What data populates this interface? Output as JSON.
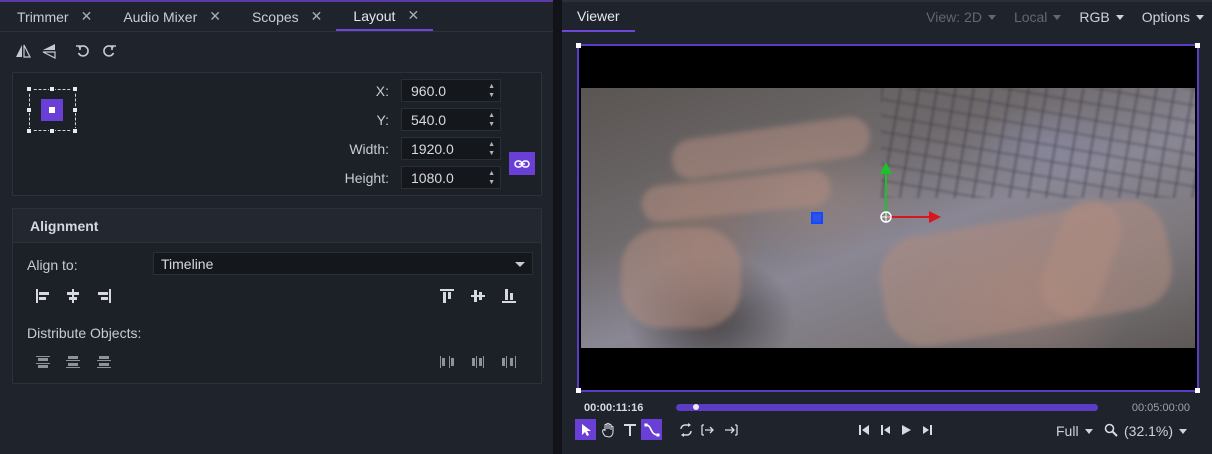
{
  "left_panel": {
    "tabs": [
      {
        "label": "Trimmer",
        "active": false
      },
      {
        "label": "Audio Mixer",
        "active": false
      },
      {
        "label": "Scopes",
        "active": false
      },
      {
        "label": "Layout",
        "active": true
      }
    ],
    "close_glyph": "✕",
    "toolbar": [
      "flip-horizontal-icon",
      "flip-vertical-icon",
      "rotate-left-icon",
      "rotate-right-icon"
    ],
    "transform": {
      "x_label": "X:",
      "x_value": "960.0",
      "y_label": "Y:",
      "y_value": "540.0",
      "width_label": "Width:",
      "width_value": "1920.0",
      "height_label": "Height:",
      "height_value": "1080.0"
    },
    "alignment": {
      "title": "Alignment",
      "align_to_label": "Align to:",
      "align_to_value": "Timeline",
      "distribute_label": "Distribute Objects:"
    }
  },
  "viewer": {
    "tab_label": "Viewer",
    "options": [
      {
        "label": "View: 2D",
        "enabled": false
      },
      {
        "label": "Local",
        "enabled": false
      },
      {
        "label": "RGB",
        "enabled": true
      },
      {
        "label": "Options",
        "enabled": true
      }
    ],
    "current_time": "00:00:11:16",
    "end_time": "00:05:00:00",
    "playhead_fraction": 0.04,
    "quality": "Full",
    "zoom": "(32.1%)"
  },
  "colors": {
    "accent": "#6a3fd6",
    "x_axis": "#d9161b",
    "y_axis": "#1fc12a",
    "selection_marker": "#1447ff"
  }
}
